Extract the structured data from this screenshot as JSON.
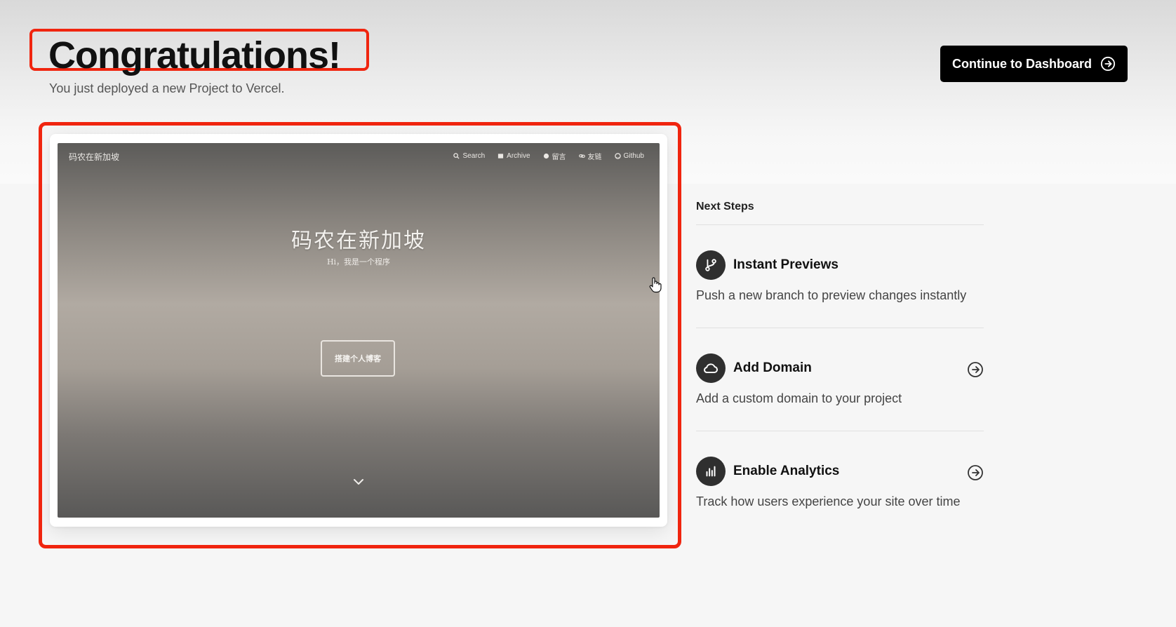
{
  "header": {
    "title": "Congratulations!",
    "subtitle": "You just deployed a new Project to Vercel.",
    "dashboard_button": "Continue to Dashboard"
  },
  "preview": {
    "site_brand": "码农在新加坡",
    "nav": [
      {
        "label": "Search",
        "icon": "search-icon"
      },
      {
        "label": "Archive",
        "icon": "archive-icon"
      },
      {
        "label": "留言",
        "icon": "comment-icon"
      },
      {
        "label": "友链",
        "icon": "link-icon"
      },
      {
        "label": "Github",
        "icon": "github-icon"
      }
    ],
    "hero_title": "码农在新加坡",
    "hero_subtitle": "Hi，我是一个程序",
    "hero_button": "搭建个人博客"
  },
  "next_steps": {
    "title": "Next Steps",
    "items": [
      {
        "title": "Instant Previews",
        "description": "Push a new branch to preview changes instantly",
        "icon": "git-branch-icon"
      },
      {
        "title": "Add Domain",
        "description": "Add a custom domain to your project",
        "icon": "cloud-icon"
      },
      {
        "title": "Enable Analytics",
        "description": "Track how users experience your site over time",
        "icon": "bar-chart-icon"
      }
    ]
  },
  "colors": {
    "highlight": "#f0250f",
    "button_bg": "#000000",
    "icon_bg": "#2f2f2f"
  }
}
